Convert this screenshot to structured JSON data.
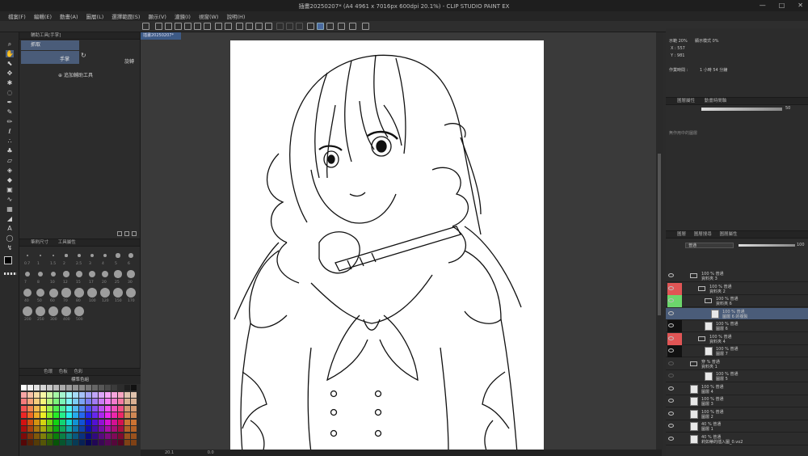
{
  "window": {
    "title": "插畫20250207* (A4 4961 x 7016px 600dpi 20.1%) - CLIP STUDIO PAINT EX",
    "minimize": "—",
    "maximize": "□",
    "close": "✕"
  },
  "menu": [
    "檔案(F)",
    "編輯(E)",
    "動畫(A)",
    "圖層(L)",
    "選擇範圍(S)",
    "顯示(V)",
    "濾鏡(I)",
    "視窗(W)",
    "說明(H)"
  ],
  "subtool": {
    "tab_label": "輔助工具[手掌]",
    "items": [
      "抓取",
      "手掌",
      "旋轉"
    ],
    "add_label": "追加輔助工具"
  },
  "brush_size": {
    "tab1": "筆刷尺寸",
    "tab2": "工具屬性",
    "labels": [
      "0.7",
      "1",
      "1.5",
      "2",
      "2.5",
      "3",
      "4",
      "5",
      "6",
      "7",
      "8",
      "10",
      "12",
      "15",
      "17",
      "20",
      "25",
      "30",
      "40",
      "50",
      "60",
      "70",
      "80",
      "100",
      "120",
      "150",
      "170",
      "200",
      "250",
      "300",
      "400",
      "500"
    ]
  },
  "colorset": {
    "tabs": [
      "色環",
      "色板",
      "色彩"
    ],
    "set_name": "標準色組"
  },
  "document": {
    "tab": "插畫20250207*"
  },
  "status": {
    "zoom": "20.1",
    "rotate": "0.0"
  },
  "navigator": {
    "zoom_label": "示範 20%",
    "display_mode": "顯示模式 0%",
    "x": "X : 557",
    "y": "Y : 981",
    "work_time_label": "作業時間 :",
    "work_time": "1 小時 54 分鐘"
  },
  "props": {
    "tab1": "圖層屬性",
    "tab2": "動畫時間軸",
    "opacity": "50",
    "info": "無作用中的圖層"
  },
  "layers": {
    "tab1": "圖層",
    "tab2": "圖層搜尋",
    "tab3": "圖層屬性",
    "blend": "普通",
    "opacity": "100",
    "rows": [
      {
        "top": "100 % 普通",
        "name": "資料夾 3",
        "kind": "folder",
        "indent": 30,
        "mark": "",
        "sel": false,
        "eye": true
      },
      {
        "top": "100 % 普通",
        "name": "資料夾 2",
        "kind": "folder",
        "indent": 40,
        "mark": "#e05555",
        "sel": false,
        "eye": true
      },
      {
        "top": "100 % 普通",
        "name": "資料夾 6",
        "kind": "folder",
        "indent": 48,
        "mark": "#6cd66c",
        "sel": false,
        "eye": true
      },
      {
        "top": "100 % 普通",
        "name": "圖層 6 的複製",
        "kind": "layer",
        "indent": 56,
        "mark": "",
        "sel": true,
        "eye": true
      },
      {
        "top": "100 % 普通",
        "name": "圖層 6",
        "kind": "layer",
        "indent": 48,
        "mark": "#111111",
        "sel": false,
        "eye": true
      },
      {
        "top": "100 % 普通",
        "name": "資料夾 4",
        "kind": "folder",
        "indent": 40,
        "mark": "#e05555",
        "sel": false,
        "eye": true
      },
      {
        "top": "100 % 普通",
        "name": "圖層 7",
        "kind": "layer",
        "indent": 48,
        "mark": "#111111",
        "sel": false,
        "eye": true
      },
      {
        "top": "穿 % 普通",
        "name": "資料夾 1",
        "kind": "folder",
        "indent": 30,
        "mark": "",
        "sel": false,
        "eye": false
      },
      {
        "top": "100 % 普通",
        "name": "圖層 5",
        "kind": "layer",
        "indent": 48,
        "mark": "",
        "sel": false,
        "eye": false
      },
      {
        "top": "100 % 普通",
        "name": "圖層 4",
        "kind": "layer",
        "indent": 30,
        "mark": "",
        "sel": false,
        "eye": true
      },
      {
        "top": "100 % 普通",
        "name": "圖層 3",
        "kind": "layer",
        "indent": 30,
        "mark": "",
        "sel": false,
        "eye": true
      },
      {
        "top": "100 % 普通",
        "name": "圖層 2",
        "kind": "layer",
        "indent": 30,
        "mark": "",
        "sel": false,
        "eye": true
      },
      {
        "top": "40 % 普通",
        "name": "圖層 1",
        "kind": "layer",
        "indent": 30,
        "mark": "",
        "sel": false,
        "eye": true
      },
      {
        "top": "40 % 普通",
        "name": "莉如蒂的插入圖_0.vo2",
        "kind": "layer",
        "indent": 30,
        "mark": "",
        "sel": false,
        "eye": true
      }
    ]
  },
  "colors": {
    "accent": "#4a5c79",
    "panel": "#2c2c2c",
    "canvas_bg": "#3a3a3a"
  }
}
